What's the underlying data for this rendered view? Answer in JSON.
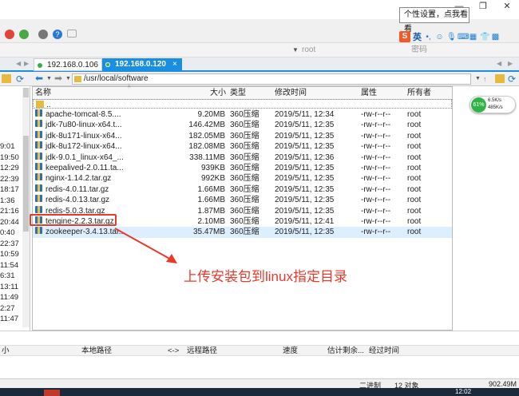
{
  "tooltip": {
    "text": "个性设置，点我看看"
  },
  "sogou": {
    "logo": "S",
    "lang": "英"
  },
  "address": {
    "user_placeholder": "root",
    "password_placeholder": "密码"
  },
  "tabs": [
    {
      "label": "192.168.0.106",
      "active": false,
      "dot_color": "#2fb344"
    },
    {
      "label": "192.168.0.120",
      "active": true,
      "dot_color": "#2fb344"
    }
  ],
  "path": {
    "value": "/usr/local/software"
  },
  "columns": {
    "name": "名称",
    "size": "大小",
    "type": "类型",
    "mtime": "修改时间",
    "attr": "属性",
    "owner": "所有者"
  },
  "parent_dir": "..",
  "files": [
    {
      "name": "apache-tomcat-8.5....",
      "size": "9.20MB",
      "type": "360压缩",
      "mtime": "2019/5/11, 12:34",
      "attr": "-rw-r--r--",
      "owner": "root"
    },
    {
      "name": "jdk-7u80-linux-x64.t...",
      "size": "146.42MB",
      "type": "360压缩",
      "mtime": "2019/5/11, 12:35",
      "attr": "-rw-r--r--",
      "owner": "root"
    },
    {
      "name": "jdk-8u171-linux-x64...",
      "size": "182.05MB",
      "type": "360压缩",
      "mtime": "2019/5/11, 12:35",
      "attr": "-rw-r--r--",
      "owner": "root"
    },
    {
      "name": "jdk-8u172-linux-x64...",
      "size": "182.08MB",
      "type": "360压缩",
      "mtime": "2019/5/11, 12:35",
      "attr": "-rw-r--r--",
      "owner": "root"
    },
    {
      "name": "jdk-9.0.1_linux-x64_...",
      "size": "338.11MB",
      "type": "360压缩",
      "mtime": "2019/5/11, 12:36",
      "attr": "-rw-r--r--",
      "owner": "root"
    },
    {
      "name": "keepalived-2.0.11.ta...",
      "size": "939KB",
      "type": "360压缩",
      "mtime": "2019/5/11, 12:35",
      "attr": "-rw-r--r--",
      "owner": "root"
    },
    {
      "name": "nginx-1.14.2.tar.gz",
      "size": "992KB",
      "type": "360压缩",
      "mtime": "2019/5/11, 12:35",
      "attr": "-rw-r--r--",
      "owner": "root"
    },
    {
      "name": "redis-4.0.11.tar.gz",
      "size": "1.66MB",
      "type": "360压缩",
      "mtime": "2019/5/11, 12:35",
      "attr": "-rw-r--r--",
      "owner": "root"
    },
    {
      "name": "redis-4.0.13.tar.gz",
      "size": "1.66MB",
      "type": "360压缩",
      "mtime": "2019/5/11, 12:35",
      "attr": "-rw-r--r--",
      "owner": "root"
    },
    {
      "name": "redis-5.0.3.tar.gz",
      "size": "1.87MB",
      "type": "360压缩",
      "mtime": "2019/5/11, 12:35",
      "attr": "-rw-r--r--",
      "owner": "root"
    },
    {
      "name": "tengine-2.2.3.tar.gz",
      "size": "2.10MB",
      "type": "360压缩",
      "mtime": "2019/5/11, 12:41",
      "attr": "-rw-r--r--",
      "owner": "root",
      "highlighted": true
    },
    {
      "name": "zookeeper-3.4.13.tar...",
      "size": "35.47MB",
      "type": "360压缩",
      "mtime": "2019/5/11, 12:35",
      "attr": "-rw-r--r--",
      "owner": "root",
      "selected": true
    }
  ],
  "left_times": [
    "9:01",
    "19:50",
    "12:29",
    "22:39",
    "18:17",
    "1:36",
    "21:16",
    "20:44",
    "0:40",
    "22:37",
    "10:59",
    "11:54",
    "6:31",
    "13:11",
    "11:49",
    "2:27",
    "11:47"
  ],
  "annotation": {
    "text": "上传安装包到linux指定目录",
    "color": "#e8392b"
  },
  "speed_widget": {
    "percent": "61%",
    "up": "6.5K/s",
    "down": "485K/s"
  },
  "transfer_headers": {
    "size": "小",
    "local_path": "本地路径",
    "arrow": "<->",
    "remote_path": "远程路径",
    "speed": "速度",
    "est_remaining": "估计剩余...",
    "elapsed": "经过时间"
  },
  "status": {
    "dirs": "二进制",
    "count": "12 对象",
    "size": "902.49M"
  },
  "taskbar": {
    "clock": "12:02"
  },
  "colors": {
    "accent": "#1a8ee0",
    "highlight_box": "#e8392b",
    "selected_row": "#ddeeff"
  }
}
